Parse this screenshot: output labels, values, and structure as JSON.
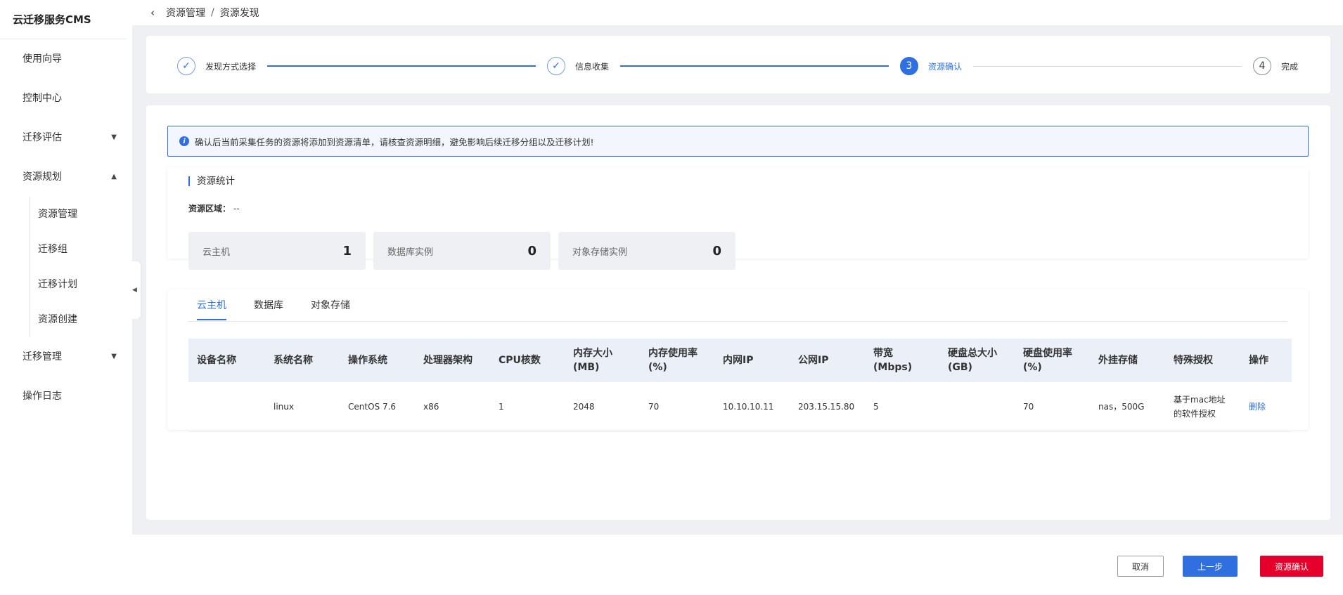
{
  "brand": "云迁移服务CMS",
  "sidebar": {
    "items": [
      {
        "label": "使用向导"
      },
      {
        "label": "控制中心"
      },
      {
        "label": "迁移评估"
      },
      {
        "label": "资源规划"
      },
      {
        "label": "迁移管理"
      },
      {
        "label": "操作日志"
      }
    ],
    "sub_items": [
      {
        "label": "资源管理"
      },
      {
        "label": "迁移组"
      },
      {
        "label": "迁移计划"
      },
      {
        "label": "资源创建"
      }
    ]
  },
  "breadcrumb": {
    "parent": "资源管理",
    "separator": "/",
    "current": "资源发现"
  },
  "steps": [
    {
      "number": "✓",
      "label": "发现方式选择",
      "state": "done"
    },
    {
      "number": "✓",
      "label": "信息收集",
      "state": "done"
    },
    {
      "number": "3",
      "label": "资源确认",
      "state": "active"
    },
    {
      "number": "4",
      "label": "完成",
      "state": "todo"
    }
  ],
  "notice": {
    "icon": "info-icon",
    "text": "确认后当前采集任务的资源将添加到资源清单，请核查资源明细，避免影响后续迁移分组以及迁移计划!"
  },
  "stats": {
    "title": "资源统计",
    "region_label": "资源区域：",
    "region_value": "--",
    "boxes": [
      {
        "label": "云主机",
        "value": "1"
      },
      {
        "label": "数据库实例",
        "value": "0"
      },
      {
        "label": "对象存储实例",
        "value": "0"
      }
    ]
  },
  "tabs": [
    {
      "label": "云主机",
      "active": true
    },
    {
      "label": "数据库",
      "active": false
    },
    {
      "label": "对象存储",
      "active": false
    }
  ],
  "table": {
    "headers": [
      "设备名称",
      "系统名称",
      "操作系统",
      "处理器架构",
      "CPU核数",
      "内存大小(MB)",
      "内存使用率(%)",
      "内网IP",
      "公网IP",
      "带宽(Mbps)",
      "硬盘总大小(GB)",
      "硬盘使用率(%)",
      "外挂存储",
      "特殊授权",
      "操作"
    ],
    "rows": [
      [
        "",
        "linux",
        "CentOS 7.6",
        "x86",
        "1",
        "2048",
        "70",
        "10.10.10.11",
        "203.15.15.80",
        "5",
        "",
        "70",
        "nas，500G",
        "基于mac地址的软件授权",
        "删除"
      ]
    ]
  },
  "footer": {
    "cancel": "取消",
    "prev": "上一步",
    "confirm": "资源确认"
  },
  "colors": {
    "primary": "#2f6fe0",
    "danger": "#e4002b"
  }
}
